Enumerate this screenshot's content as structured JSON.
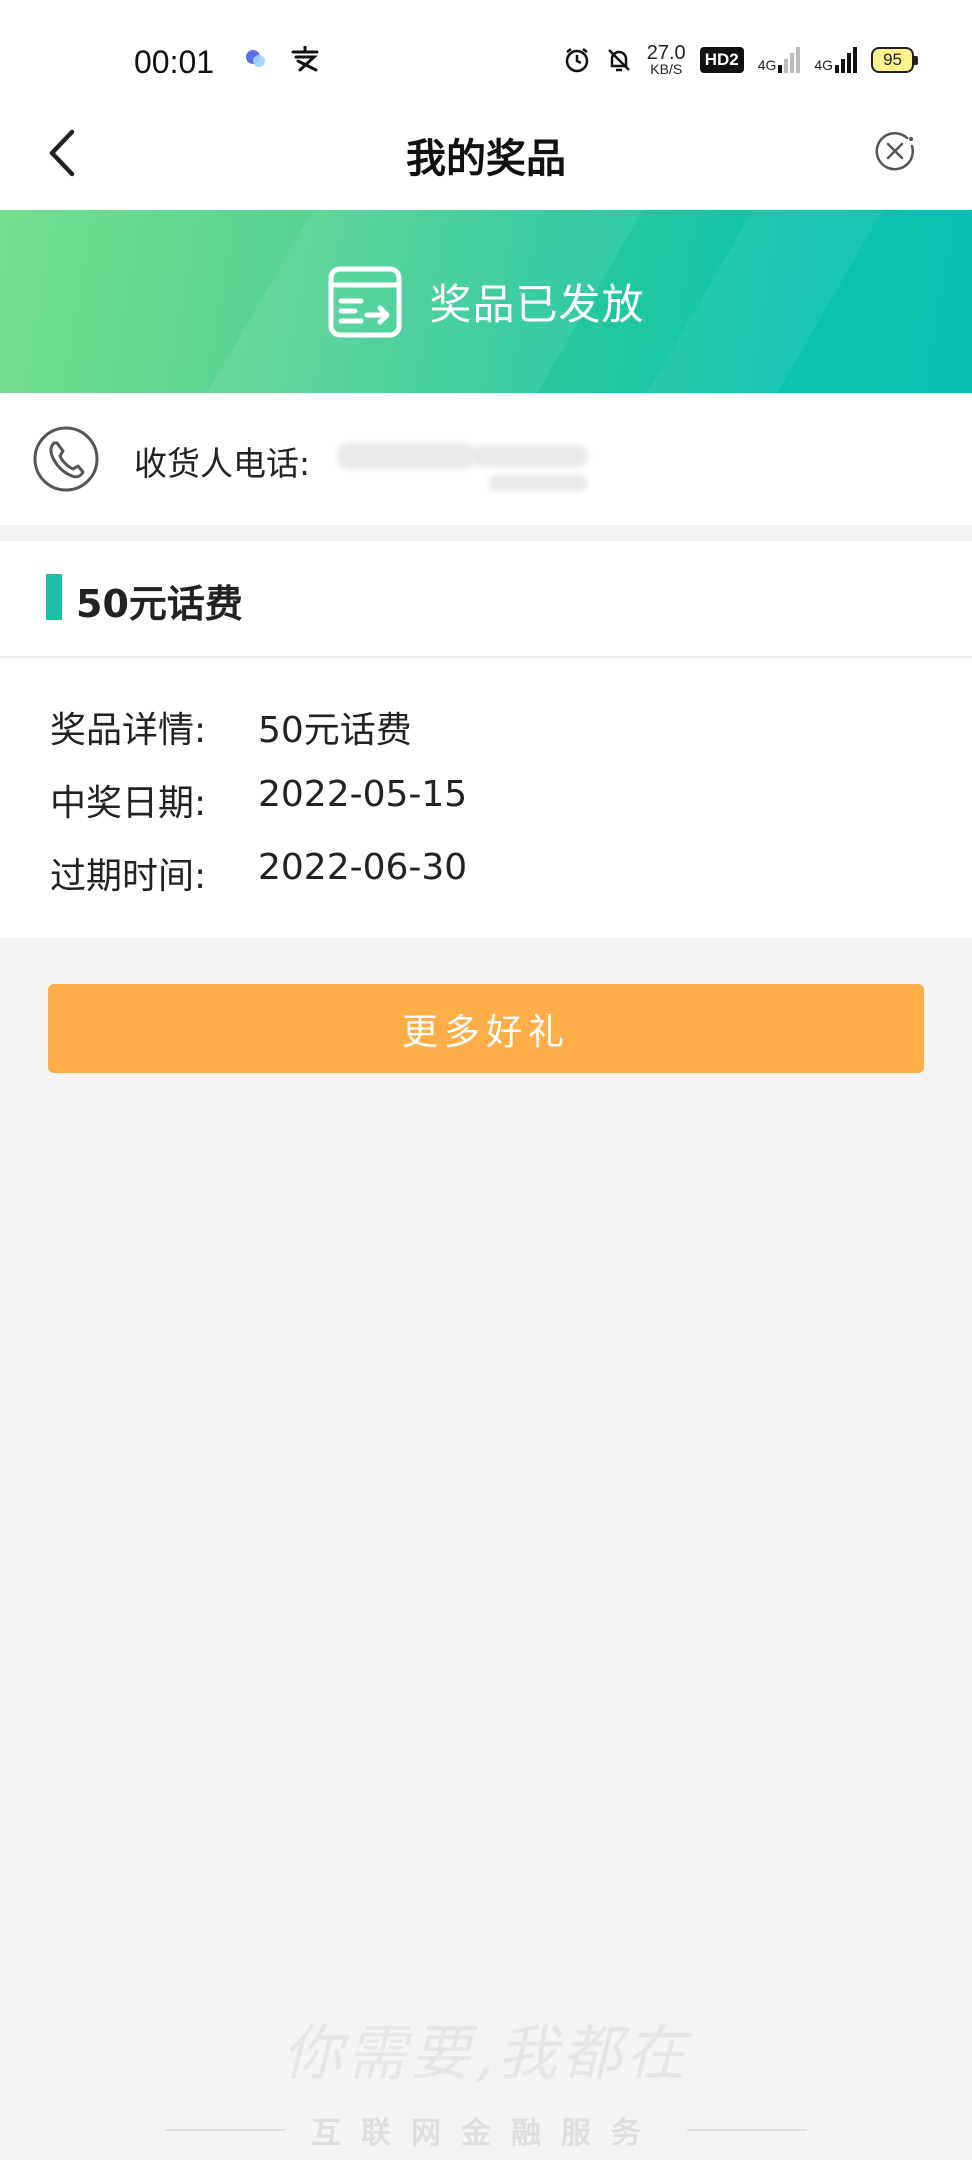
{
  "status_bar": {
    "time": "00:01",
    "speed_value": "27.0",
    "speed_unit": "KB/S",
    "hd": "HD2",
    "net1": "4G",
    "net2": "4G",
    "battery": "95"
  },
  "nav": {
    "title": "我的奖品"
  },
  "banner": {
    "text": "奖品已发放"
  },
  "contact": {
    "label": "收货人电话:"
  },
  "prize": {
    "title": "50元话费",
    "details": [
      {
        "label": "奖品详情:",
        "value": "50元话费"
      },
      {
        "label": "中奖日期:",
        "value": "2022-05-15"
      },
      {
        "label": "过期时间:",
        "value": "2022-06-30"
      }
    ]
  },
  "more_button": {
    "label": "更多好礼"
  },
  "footer": {
    "slogan": "你需要,我都在",
    "tagline": "互联网金融服务"
  },
  "colors": {
    "banner_start": "#74de8f",
    "banner_end": "#07c0b2",
    "accent": "#1cbfa6",
    "button": "#ffae47"
  }
}
